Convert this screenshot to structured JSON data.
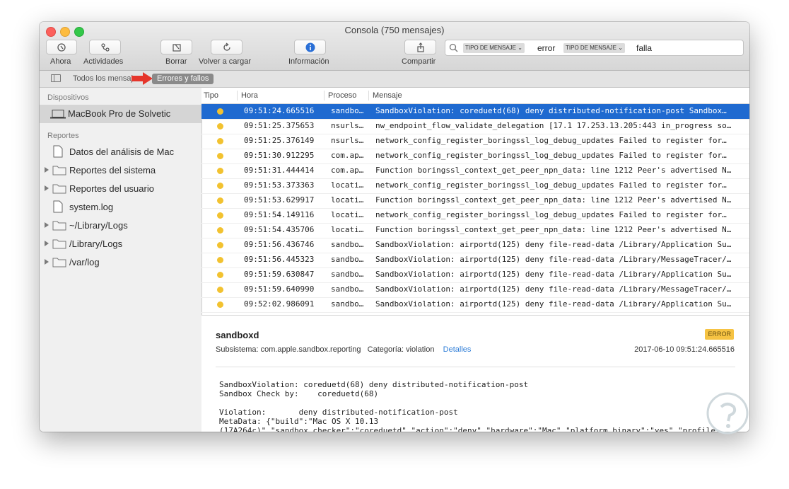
{
  "window": {
    "title": "Consola (750 mensajes)"
  },
  "toolbar": {
    "now_label": "Ahora",
    "activities_label": "Actividades",
    "clear_label": "Borrar",
    "reload_label": "Volver a cargar",
    "info_label": "Información",
    "share_label": "Compartir"
  },
  "search": {
    "token1_label": "TIPO DE MENSAJE ⌄",
    "token1_value": "error",
    "token2_label": "TIPO DE MENSAJE ⌄",
    "token2_value": "falla"
  },
  "filterbar": {
    "all_messages": "Todos los mensajes",
    "errors_faults": "Errores y fallos"
  },
  "sidebar": {
    "devices_header": "Dispositivos",
    "device": "MacBook Pro de Solvetic",
    "reports_header": "Reportes",
    "items": [
      {
        "label": "Datos del análisis de Mac"
      },
      {
        "label": "Reportes del sistema"
      },
      {
        "label": "Reportes del usuario"
      },
      {
        "label": "system.log"
      },
      {
        "label": "~/Library/Logs"
      },
      {
        "label": "/Library/Logs"
      },
      {
        "label": "/var/log"
      }
    ]
  },
  "table": {
    "columns": {
      "type": "Tipo",
      "time": "Hora",
      "process": "Proceso",
      "message": "Mensaje"
    },
    "rows": [
      {
        "time": "09:51:24.665516",
        "process": "sandbo…",
        "message": "SandboxViolation: coreduetd(68) deny distributed-notification-post Sandbox…"
      },
      {
        "time": "09:51:25.375653",
        "process": "nsurls…",
        "message": "nw_endpoint_flow_validate_delegation [17.1 17.253.13.205:443 in_progress so…"
      },
      {
        "time": "09:51:25.376149",
        "process": "nsurls…",
        "message": "network_config_register_boringssl_log_debug_updates Failed to register for…"
      },
      {
        "time": "09:51:30.912295",
        "process": "com.ap…",
        "message": "network_config_register_boringssl_log_debug_updates Failed to register for…"
      },
      {
        "time": "09:51:31.444414",
        "process": "com.ap…",
        "message": "Function boringssl_context_get_peer_npn_data: line 1212 Peer's advertised N…"
      },
      {
        "time": "09:51:53.373363",
        "process": "locati…",
        "message": "network_config_register_boringssl_log_debug_updates Failed to register for…"
      },
      {
        "time": "09:51:53.629917",
        "process": "locati…",
        "message": "Function boringssl_context_get_peer_npn_data: line 1212 Peer's advertised N…"
      },
      {
        "time": "09:51:54.149116",
        "process": "locati…",
        "message": "network_config_register_boringssl_log_debug_updates Failed to register for…"
      },
      {
        "time": "09:51:54.435706",
        "process": "locati…",
        "message": "Function boringssl_context_get_peer_npn_data: line 1212 Peer's advertised N…"
      },
      {
        "time": "09:51:56.436746",
        "process": "sandbo…",
        "message": "SandboxViolation: airportd(125) deny file-read-data /Library/Application Su…"
      },
      {
        "time": "09:51:56.445323",
        "process": "sandbo…",
        "message": "SandboxViolation: airportd(125) deny file-read-data /Library/MessageTracer/…"
      },
      {
        "time": "09:51:59.630847",
        "process": "sandbo…",
        "message": "SandboxViolation: airportd(125) deny file-read-data /Library/Application Su…"
      },
      {
        "time": "09:51:59.640990",
        "process": "sandbo…",
        "message": "SandboxViolation: airportd(125) deny file-read-data /Library/MessageTracer/…"
      },
      {
        "time": "09:52:02.986091",
        "process": "sandbo…",
        "message": "SandboxViolation: airportd(125) deny file-read-data /Library/Application Su…"
      }
    ]
  },
  "detail": {
    "process": "sandboxd",
    "badge": "ERROR",
    "subsystem_label": "Subsistema:",
    "subsystem": "com.apple.sandbox.reporting",
    "category_label": "Categoría:",
    "category": "violation",
    "details_link": "Detalles",
    "date": "2017-06-10 09:51:24.665516",
    "body": "SandboxViolation: coreduetd(68) deny distributed-notification-post\nSandbox Check by:    coreduetd(68)\n\nViolation:       deny distributed-notification-post\nMetaData: {\"build\":\"Mac OS X 10.13\n(17A264c)\",\"sandbox_checker\":\"coreduetd\",\"action\":\"deny\",\"hardware\":\"Mac\",\"platform_binary\":\"yes\",\"profile"
  },
  "colors": {
    "selection": "#1f6ad0",
    "error_dot": "#f2c230",
    "badge": "#f6c343",
    "link": "#2e7dd7"
  }
}
